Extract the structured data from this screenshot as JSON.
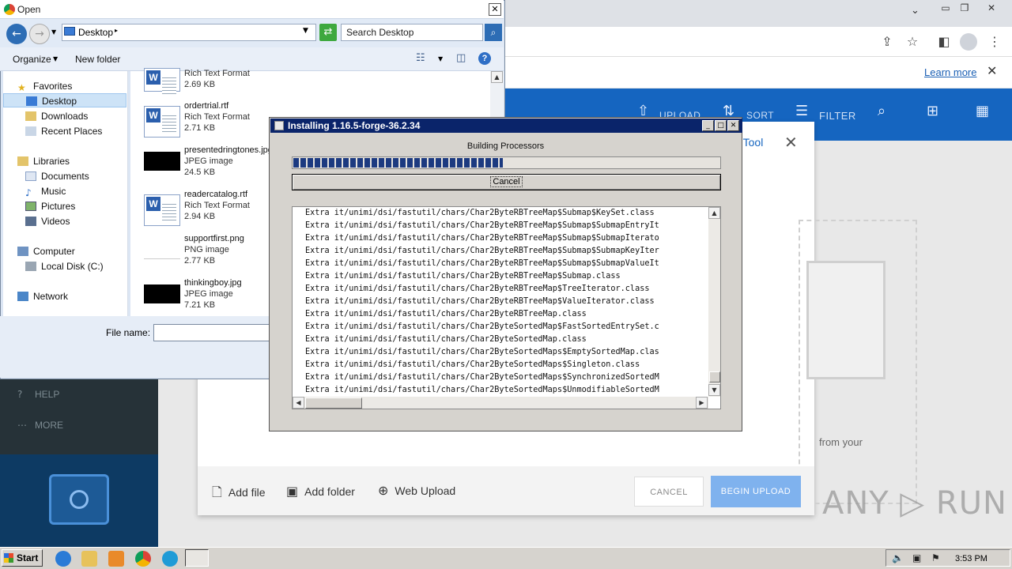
{
  "browser": {
    "notice_link": "Learn more"
  },
  "app": {
    "header": {
      "upload": "UPLOAD",
      "sort": "SORT",
      "filter": "FILTER"
    },
    "sidebar": {
      "help": "HELP",
      "more": "MORE"
    },
    "modal": {
      "title_fragment": "c Tool",
      "drop_text_fragment": "from your",
      "add_file": "Add file",
      "add_folder": "Add folder",
      "web_upload": "Web Upload",
      "cancel": "CANCEL",
      "begin_upload": "BEGIN UPLOAD"
    },
    "watermark": "ANY ▷ RUN"
  },
  "open_dialog": {
    "title": "Open",
    "address": "Desktop",
    "search_placeholder": "Search Desktop",
    "organize": "Organize",
    "new_folder": "New folder",
    "nav": {
      "favorites": "Favorites",
      "desktop": "Desktop",
      "downloads": "Downloads",
      "recent_places": "Recent Places",
      "libraries": "Libraries",
      "documents": "Documents",
      "music": "Music",
      "pictures": "Pictures",
      "videos": "Videos",
      "computer": "Computer",
      "local_disk": "Local Disk (C:)",
      "network": "Network"
    },
    "files": [
      {
        "name": "",
        "type": "Rich Text Format",
        "size": "2.69 KB"
      },
      {
        "name": "ordertrial.rtf",
        "type": "Rich Text Format",
        "size": "2.71 KB"
      },
      {
        "name": "presentedringtones.jpg",
        "type": "JPEG image",
        "size": "24.5 KB"
      },
      {
        "name": "readercatalog.rtf",
        "type": "Rich Text Format",
        "size": "2.94 KB"
      },
      {
        "name": "supportfirst.png",
        "type": "PNG image",
        "size": "2.77 KB"
      },
      {
        "name": "thinkingboy.jpg",
        "type": "JPEG image",
        "size": "7.21 KB"
      }
    ],
    "file_name_label": "File name:",
    "file_name_value": ""
  },
  "installer": {
    "title": "Installing 1.16.5-forge-36.2.34",
    "status": "Building Processors",
    "progress": 0.49,
    "cancel": "Cancel",
    "log": [
      "Extra it/unimi/dsi/fastutil/chars/Char2ByteRBTreeMap$Submap$KeySet.class",
      "Extra it/unimi/dsi/fastutil/chars/Char2ByteRBTreeMap$Submap$SubmapEntryIt",
      "Extra it/unimi/dsi/fastutil/chars/Char2ByteRBTreeMap$Submap$SubmapIterato",
      "Extra it/unimi/dsi/fastutil/chars/Char2ByteRBTreeMap$Submap$SubmapKeyIter",
      "Extra it/unimi/dsi/fastutil/chars/Char2ByteRBTreeMap$Submap$SubmapValueIt",
      "Extra it/unimi/dsi/fastutil/chars/Char2ByteRBTreeMap$Submap.class",
      "Extra it/unimi/dsi/fastutil/chars/Char2ByteRBTreeMap$TreeIterator.class",
      "Extra it/unimi/dsi/fastutil/chars/Char2ByteRBTreeMap$ValueIterator.class",
      "Extra it/unimi/dsi/fastutil/chars/Char2ByteRBTreeMap.class",
      "Extra it/unimi/dsi/fastutil/chars/Char2ByteSortedMap$FastSortedEntrySet.c",
      "Extra it/unimi/dsi/fastutil/chars/Char2ByteSortedMap.class",
      "Extra it/unimi/dsi/fastutil/chars/Char2ByteSortedMaps$EmptySortedMap.clas",
      "Extra it/unimi/dsi/fastutil/chars/Char2ByteSortedMaps$Singleton.class",
      "Extra it/unimi/dsi/fastutil/chars/Char2ByteSortedMaps$SynchronizedSortedM",
      "Extra it/unimi/dsi/fastutil/chars/Char2ByteSortedMaps$UnmodifiableSortedM"
    ]
  },
  "taskbar": {
    "start": "Start",
    "clock": "3:53 PM"
  }
}
